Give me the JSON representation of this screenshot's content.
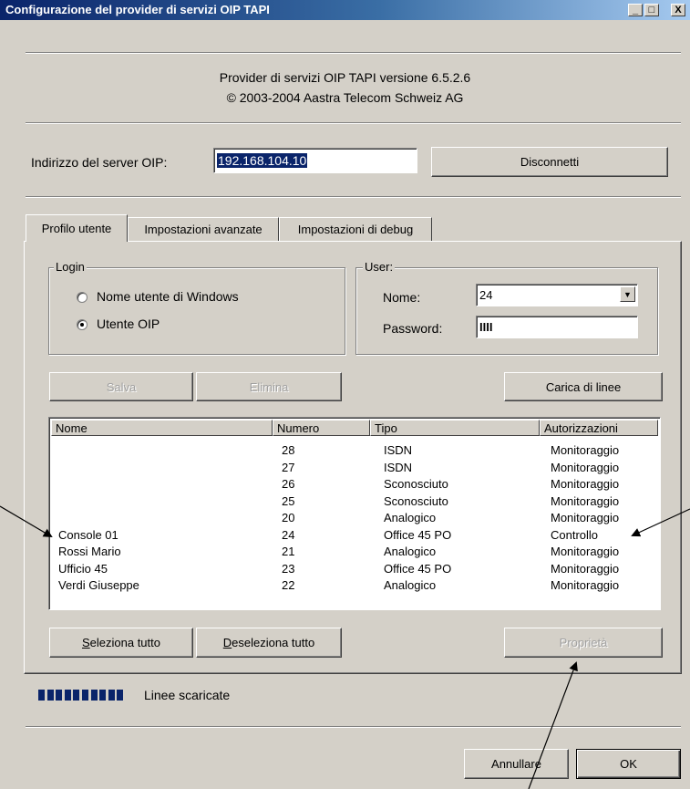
{
  "window": {
    "title": "Configurazione del provider di servizi OIP TAPI",
    "minimize_glyph": "_",
    "maximize_glyph": "□",
    "close_glyph": "X"
  },
  "header": {
    "version_line": "Provider di servizi OIP TAPI versione 6.5.2.6",
    "copyright_line": "© 2003-2004 Aastra Telecom Schweiz AG"
  },
  "server": {
    "label": "Indirizzo del server OIP:",
    "value": "192.168.104.10",
    "disconnect_label": "Disconnetti"
  },
  "tabs": [
    {
      "label": "Profilo utente",
      "active": true
    },
    {
      "label": "Impostazioni avanzate",
      "active": false
    },
    {
      "label": "Impostazioni di debug",
      "active": false
    }
  ],
  "login": {
    "group_label": "Login",
    "option_windows": "Nome utente di Windows",
    "option_oip": "Utente OIP",
    "selected": "Utente OIP"
  },
  "user": {
    "group_label": "User:",
    "name_label": "Nome:",
    "name_value": "24",
    "password_label": "Password:",
    "password_value": "IIII"
  },
  "actions": {
    "save_label": "Salva",
    "delete_label": "Elimina",
    "load_lines_label": "Carica di linee"
  },
  "table": {
    "columns": [
      "Nome",
      "Numero",
      "Tipo",
      "Autorizzazioni"
    ],
    "rows": [
      [
        "",
        "28",
        "ISDN",
        "Monitoraggio"
      ],
      [
        "",
        "27",
        "ISDN",
        "Monitoraggio"
      ],
      [
        "",
        "26",
        "Sconosciuto",
        "Monitoraggio"
      ],
      [
        "",
        "25",
        "Sconosciuto",
        "Monitoraggio"
      ],
      [
        "",
        "20",
        "Analogico",
        "Monitoraggio"
      ],
      [
        "Console 01",
        "24",
        "Office 45 PO",
        "Controllo"
      ],
      [
        "Rossi Mario",
        "21",
        "Analogico",
        "Monitoraggio"
      ],
      [
        "Ufficio 45",
        "23",
        "Office 45 PO",
        "Monitoraggio"
      ],
      [
        "Verdi Giuseppe",
        "22",
        "Analogico",
        "Monitoraggio"
      ]
    ]
  },
  "selection": {
    "select_all_key": "S",
    "select_all_rest": "eleziona tutto",
    "deselect_all_key": "D",
    "deselect_all_rest": "eseleziona tutto",
    "properties_label": "Proprietà"
  },
  "status": {
    "progress_fraction": 1.0,
    "progress_blocks": 10,
    "text": "Linee scaricate"
  },
  "footer": {
    "cancel_label": "Annullare",
    "ok_label": "OK"
  },
  "colors": {
    "title_active": "#0a246a",
    "face": "#d4d0c8",
    "selection": "#0a246a"
  }
}
